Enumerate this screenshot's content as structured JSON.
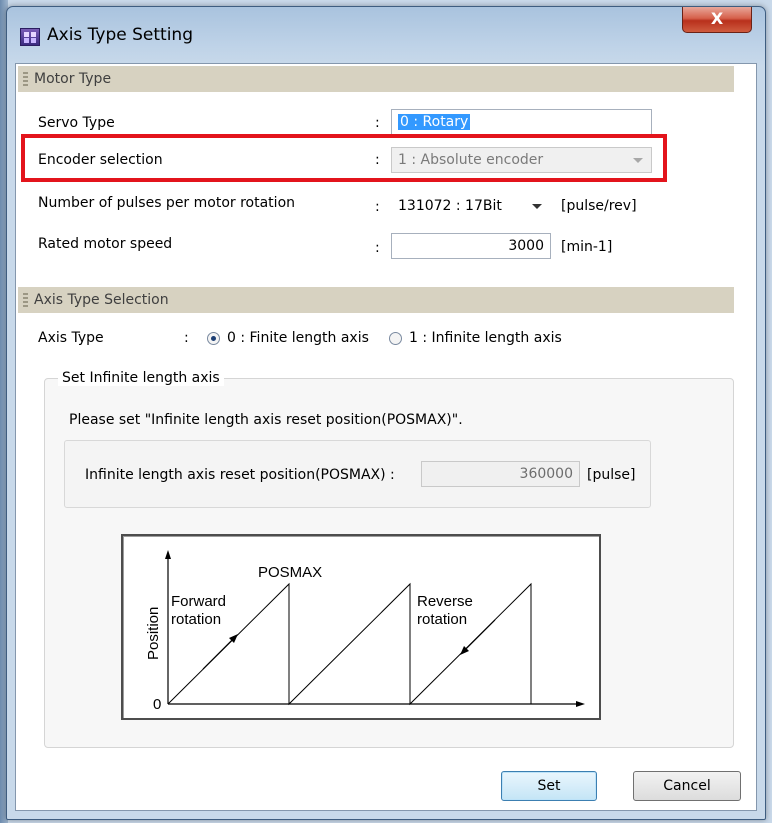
{
  "window": {
    "title": "Axis Type Setting",
    "close_label": "X"
  },
  "motor_type": {
    "header": "Motor Type",
    "servo_type": {
      "label": "Servo Type",
      "colon": ":",
      "value": "0 : Rotary"
    },
    "encoder_selection": {
      "label": "Encoder selection",
      "colon": ":",
      "value": "1 : Absolute encoder"
    },
    "pulses": {
      "label": "Number of pulses per motor rotation",
      "colon": ":",
      "value": "131072 : 17Bit",
      "unit": "[pulse/rev]"
    },
    "rated_speed": {
      "label": "Rated motor speed",
      "colon": ":",
      "value": "3000",
      "unit": "[min-1]"
    }
  },
  "axis_selection": {
    "header": "Axis Type Selection",
    "label": "Axis Type",
    "colon": ":",
    "options": [
      {
        "label": "0 : Finite length axis",
        "checked": true
      },
      {
        "label": "1 : Infinite length axis",
        "checked": false
      }
    ]
  },
  "infinite_group": {
    "legend": "Set Infinite length axis",
    "instruction": "Please set \"Infinite length axis reset position(POSMAX)\".",
    "posmax": {
      "label": "Infinite length axis reset position(POSMAX) :",
      "value": "360000",
      "unit": "[pulse]"
    }
  },
  "diagram": {
    "posmax_label": "POSMAX",
    "y_axis_label": "Position",
    "origin_label": "0",
    "forward_label_1": "Forward",
    "forward_label_2": "rotation",
    "reverse_label_1": "Reverse",
    "reverse_label_2": "rotation"
  },
  "buttons": {
    "set": "Set",
    "cancel": "Cancel"
  },
  "colors": {
    "highlight": "#e3141c",
    "selection": "#3399ff",
    "section_header": "#d7d2c1"
  }
}
